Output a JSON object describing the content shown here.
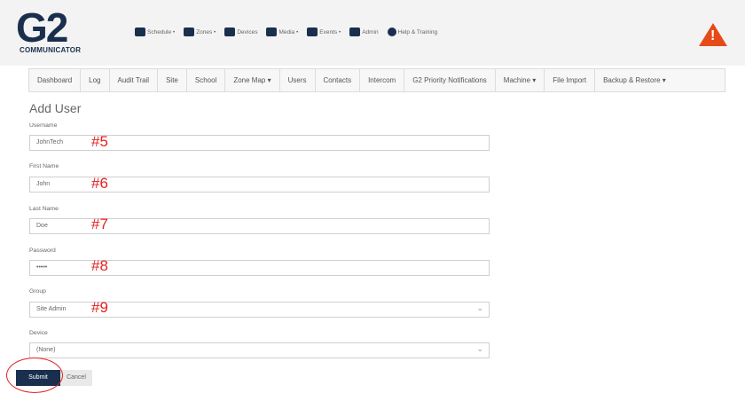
{
  "app": {
    "logo_text": "G2",
    "logo_sub": "COMMUNICATOR",
    "top_nav": [
      "Schedule •",
      "Zones •",
      "Devices",
      "Media •",
      "Events •",
      "Admin",
      "Help & Training"
    ]
  },
  "tabs": [
    "Dashboard",
    "Log",
    "Audit Trail",
    "Site",
    "School",
    "Zone Map ▾",
    "Users",
    "Contacts",
    "Intercom",
    "G2 Priority Notifications",
    "Machine ▾",
    "File Import",
    "Backup & Restore ▾"
  ],
  "form": {
    "title": "Add User",
    "username": {
      "label": "Username",
      "value": "JohnTech"
    },
    "first_name": {
      "label": "First Name",
      "value": "John"
    },
    "last_name": {
      "label": "Last Name",
      "value": "Doe"
    },
    "password": {
      "label": "Password",
      "value": "•••••"
    },
    "group": {
      "label": "Group",
      "value": "Site Admin"
    },
    "device": {
      "label": "Device",
      "value": "(None)"
    },
    "submit": "Submit",
    "cancel": "Cancel"
  },
  "annotations": [
    "#5",
    "#6",
    "#7",
    "#8",
    "#9"
  ],
  "colors": {
    "brand": "#1a2f4d",
    "warning": "#e64a19",
    "annotation": "#e62020"
  }
}
